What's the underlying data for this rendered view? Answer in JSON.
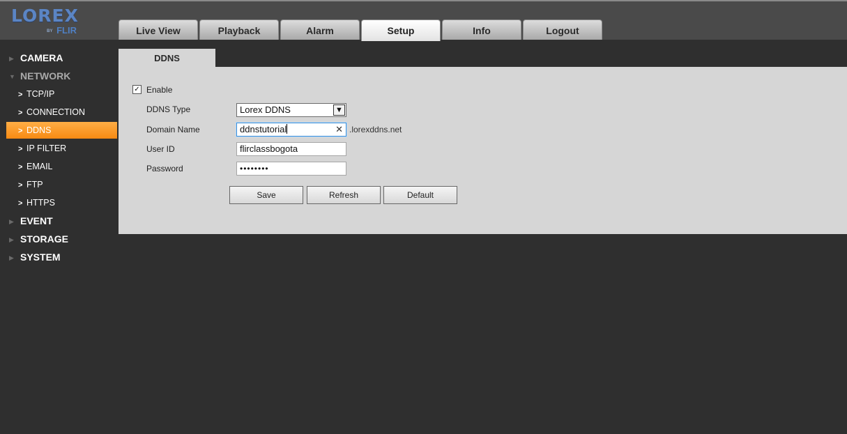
{
  "header": {
    "brand": "LOREX",
    "brand_sub_prefix": "BY",
    "brand_sub": "FLIR",
    "tabs": [
      {
        "label": "Live View"
      },
      {
        "label": "Playback"
      },
      {
        "label": "Alarm"
      },
      {
        "label": "Setup",
        "active": true
      },
      {
        "label": "Info"
      },
      {
        "label": "Logout"
      }
    ]
  },
  "sidebar": {
    "categories": [
      {
        "label": "CAMERA"
      },
      {
        "label": "NETWORK",
        "expanded": true
      },
      {
        "label": "EVENT"
      },
      {
        "label": "STORAGE"
      },
      {
        "label": "SYSTEM"
      }
    ],
    "network_items": [
      {
        "label": "TCP/IP"
      },
      {
        "label": "CONNECTION"
      },
      {
        "label": "DDNS",
        "active": true
      },
      {
        "label": "IP FILTER"
      },
      {
        "label": "EMAIL"
      },
      {
        "label": "FTP"
      },
      {
        "label": "HTTPS"
      }
    ]
  },
  "page": {
    "tab_label": "DDNS",
    "enable_label": "Enable",
    "enable_checked": true,
    "ddns_type_label": "DDNS Type",
    "ddns_type_value": "Lorex DDNS",
    "domain_label": "Domain Name",
    "domain_value": "ddnstutorial",
    "domain_suffix": ".lorexddns.net",
    "user_label": "User ID",
    "user_value": "flirclassbogota",
    "password_label": "Password",
    "password_value": "••••••••",
    "buttons": {
      "save": "Save",
      "refresh": "Refresh",
      "default": "Default"
    }
  },
  "colors": {
    "accent": "#f78a13",
    "topbar": "#4a4a4a",
    "background": "#2f2f2f",
    "panel": "#d6d6d6",
    "brand": "#5b85c4"
  }
}
